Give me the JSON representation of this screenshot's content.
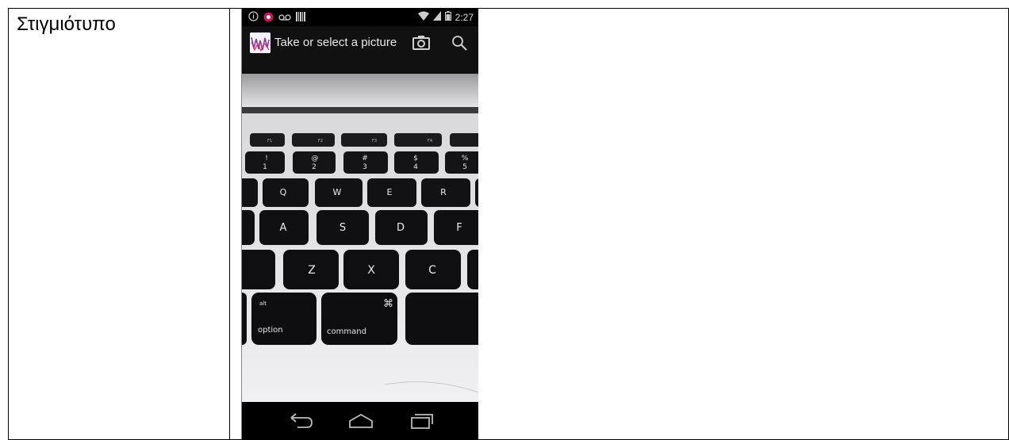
{
  "document": {
    "label": "Στιγμιότυπο"
  },
  "phone": {
    "status": {
      "time": "2:27",
      "icons": [
        "info-icon",
        "notification-app-icon",
        "voicemail-icon",
        "barcode-icon",
        "wifi-icon",
        "signal-icon",
        "battery-icon"
      ]
    },
    "action_bar": {
      "title": "Take or select a picture",
      "actions": [
        "camera-icon",
        "search-icon"
      ]
    },
    "photo": {
      "keys": {
        "fn_row": [
          "F1",
          "F2",
          "F3",
          "F4"
        ],
        "number_row": [
          {
            "top": "!",
            "bottom": "1"
          },
          {
            "top": "@",
            "bottom": "2"
          },
          {
            "top": "#",
            "bottom": "3"
          },
          {
            "top": "$",
            "bottom": "4"
          },
          {
            "top": "%",
            "bottom": "5"
          }
        ],
        "qwerty_row": [
          "Q",
          "W",
          "E",
          "R"
        ],
        "asdf_row": [
          "A",
          "S",
          "D",
          "F"
        ],
        "zxcv_row": [
          "Z",
          "X",
          "C"
        ],
        "option_top": "alt",
        "option": "option",
        "command_symbol": "⌘",
        "command": "command"
      }
    },
    "nav": [
      "back-icon",
      "home-icon",
      "recents-icon"
    ]
  }
}
